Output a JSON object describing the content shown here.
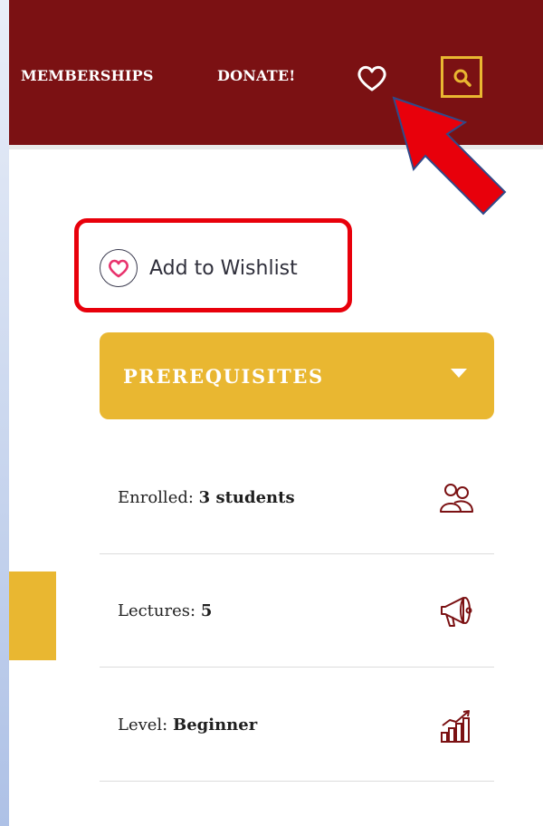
{
  "nav": {
    "memberships": "MEMBERSHIPS",
    "donate": "DONATE!",
    "icons": [
      "heart-icon",
      "search-icon"
    ]
  },
  "wishlist": {
    "label": "Add to Wishlist",
    "icon": "heart-icon"
  },
  "prerequisites": {
    "label": "PREREQUISITES",
    "icon": "caret-down-icon"
  },
  "info": [
    {
      "label": "Enrolled:",
      "value": "3 students",
      "icon": "students-icon"
    },
    {
      "label": "Lectures:",
      "value": "5",
      "icon": "megaphone-icon"
    },
    {
      "label": "Level:",
      "value": "Beginner",
      "icon": "level-chart-icon"
    }
  ],
  "colors": {
    "header": "#7b1113",
    "accent": "#e9b731",
    "highlight": "#e8000b",
    "heart": "#e8336d"
  }
}
